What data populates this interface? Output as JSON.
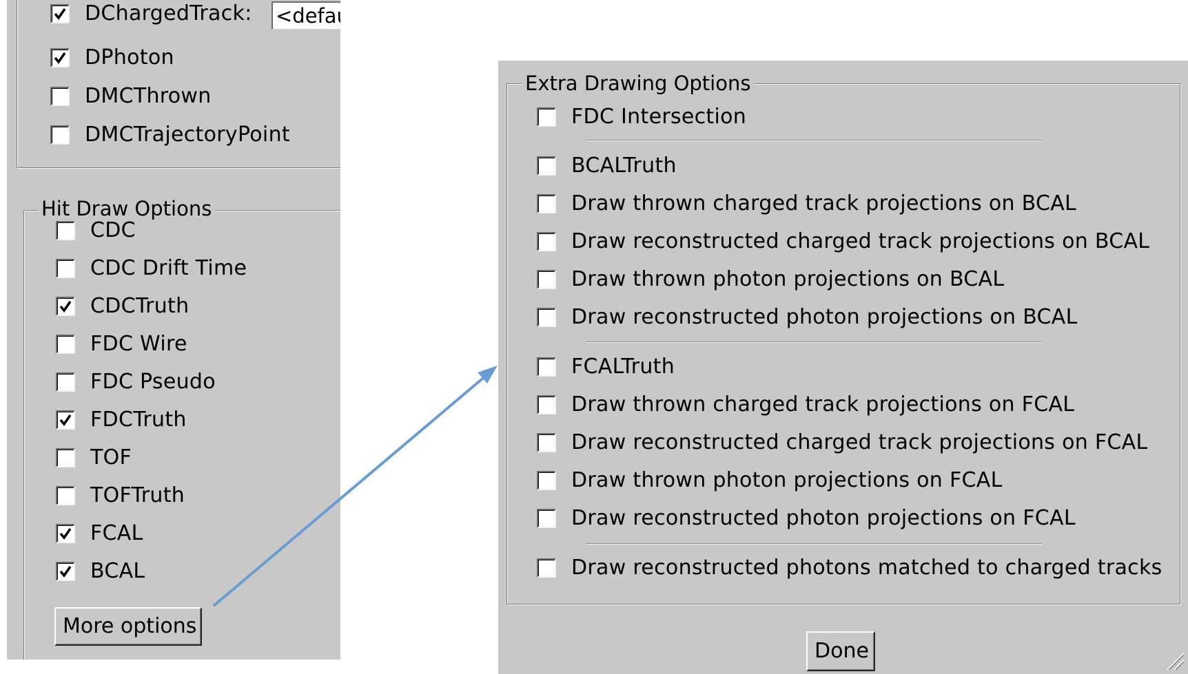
{
  "left_panel": {
    "top_items": [
      {
        "label": "DChargedTrack:",
        "checked": true,
        "field_value": "<defau"
      },
      {
        "label": "DPhoton",
        "checked": true
      },
      {
        "label": "DMCThrown",
        "checked": false
      },
      {
        "label": "DMCTrajectoryPoint",
        "checked": false
      }
    ],
    "hit_group": {
      "legend": "Hit Draw Options",
      "items": [
        {
          "label": "CDC",
          "checked": false
        },
        {
          "label": "CDC Drift Time",
          "checked": false
        },
        {
          "label": "CDCTruth",
          "checked": true
        },
        {
          "label": "FDC Wire",
          "checked": false
        },
        {
          "label": "FDC Pseudo",
          "checked": false
        },
        {
          "label": "FDCTruth",
          "checked": true
        },
        {
          "label": "TOF",
          "checked": false
        },
        {
          "label": "TOFTruth",
          "checked": false
        },
        {
          "label": "FCAL",
          "checked": true
        },
        {
          "label": "BCAL",
          "checked": true
        }
      ],
      "more_options_label": "More options"
    }
  },
  "right_panel": {
    "group": {
      "legend": "Extra Drawing Options",
      "items": [
        {
          "label": "FDC Intersection",
          "checked": false
        },
        {
          "label": "BCALTruth",
          "checked": false
        },
        {
          "label": "Draw thrown charged track projections on BCAL",
          "checked": false
        },
        {
          "label": "Draw reconstructed charged track projections on BCAL",
          "checked": false
        },
        {
          "label": "Draw thrown photon projections on BCAL",
          "checked": false
        },
        {
          "label": "Draw reconstructed photon projections on BCAL",
          "checked": false
        },
        {
          "label": "FCALTruth",
          "checked": false
        },
        {
          "label": "Draw thrown charged track projections on FCAL",
          "checked": false
        },
        {
          "label": "Draw reconstructed charged track projections on FCAL",
          "checked": false
        },
        {
          "label": "Draw thrown photon projections on FCAL",
          "checked": false
        },
        {
          "label": "Draw reconstructed photon projections on FCAL",
          "checked": false
        },
        {
          "label": "Draw reconstructed photons matched to charged tracks",
          "checked": false
        }
      ]
    },
    "done_label": "Done"
  },
  "colors": {
    "panel_bg": "#c8c8c8",
    "arrow": "#6a9bd1"
  },
  "icons": {
    "checkmark": "checkmark-icon",
    "resize": "resize-grip-icon",
    "arrow": "arrow-icon"
  }
}
